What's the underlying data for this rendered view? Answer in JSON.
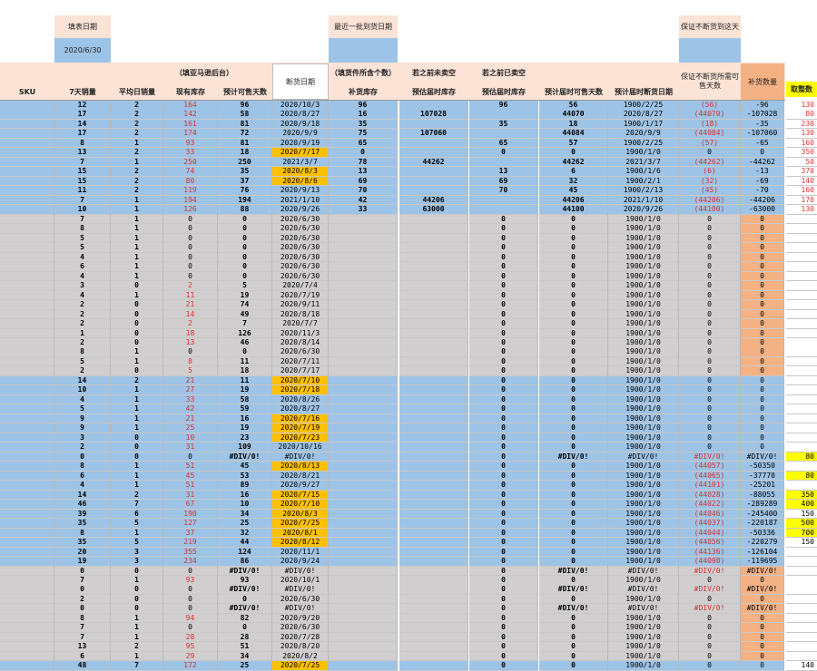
{
  "top": {
    "fill_date_label": "填表日期",
    "fill_date_value": "2020/6/30",
    "last_batch_label": "最近一批到货日期",
    "keep_stock_label": "保证不断货到这天"
  },
  "headers": {
    "amazon_backend": "（填亚马逊后台）",
    "arrival_qty": "（填货件所含个数）",
    "if_not_sold_out": "若之前未卖空",
    "if_sold_out": "若之前已卖空",
    "sku": "SKU",
    "sales_7d": "7天销量",
    "avg_daily": "平均日销量",
    "stock": "现有库存",
    "days_sellable": "预计可售天数",
    "sold_out_date": "断货日期",
    "restock": "补货库存",
    "est_stock_not": "预估届时库存",
    "est_stock_sold": "预估届时库存",
    "est_days": "预计届时可售天数",
    "est_sold_out_date": "预计届时断货日期",
    "keep_stock_days": "保证不断货所需可售天数",
    "restock_qty": "补货数量",
    "ship_qty": "取整数"
  },
  "colors": {
    "blue": "#9dc3e6",
    "gray": "#d0cece",
    "peach": "#fbe3d6",
    "orange": "#ffc000",
    "salmon": "#f4b183",
    "yellow": "#ffff00",
    "red_text": "#e03030"
  },
  "rows": [
    {
      "bg": "blue",
      "a": "12",
      "b": "2",
      "c": "164",
      "d": "96",
      "e": "2020/10/3",
      "f": "96",
      "g": "",
      "h": "96",
      "i": "56",
      "j": "1900/2/25",
      "k": "(56)",
      "l": "-96",
      "m": "130"
    },
    {
      "bg": "blue",
      "a": "17",
      "b": "2",
      "c": "142",
      "d": "58",
      "e": "2020/8/27",
      "f": "16",
      "g": "107028",
      "h": "",
      "i": "44070",
      "j": "2020/8/27",
      "k": "(44070)",
      "l": "-107028",
      "m": "80"
    },
    {
      "bg": "blue",
      "a": "14",
      "b": "2",
      "c": "161",
      "d": "81",
      "e": "2020/9/18",
      "f": "35",
      "g": "",
      "h": "35",
      "i": "18",
      "j": "1900/1/17",
      "k": "(18)",
      "l": "-35",
      "m": "230"
    },
    {
      "bg": "blue",
      "a": "17",
      "b": "2",
      "c": "174",
      "d": "72",
      "e": "2020/9/9",
      "f": "75",
      "g": "107060",
      "h": "",
      "i": "44084",
      "j": "2020/9/9",
      "k": "(44084)",
      "l": "-107060",
      "m": "130"
    },
    {
      "bg": "blue",
      "a": "8",
      "b": "1",
      "c": "93",
      "d": "81",
      "e": "2020/9/19",
      "f": "65",
      "g": "",
      "h": "65",
      "i": "57",
      "j": "1900/2/25",
      "k": "(57)",
      "l": "-65",
      "m": "160"
    },
    {
      "bg": "blue",
      "a": "13",
      "b": "2",
      "c": "33",
      "d": "18",
      "e": "2020/7/17",
      "eo": 1,
      "f": "0",
      "g": "",
      "h": "0",
      "i": "0",
      "j": "1900/1/0",
      "k": "0",
      "l": "0",
      "m": "350"
    },
    {
      "bg": "blue",
      "a": "7",
      "b": "1",
      "c": "250",
      "d": "250",
      "e": "2021/3/7",
      "f": "78",
      "g": "44262",
      "h": "",
      "i": "44262",
      "j": "2021/3/7",
      "k": "(44262)",
      "l": "-44262",
      "m": "50"
    },
    {
      "bg": "blue",
      "a": "15",
      "b": "2",
      "c": "74",
      "d": "35",
      "e": "2020/8/3",
      "eo": 1,
      "f": "13",
      "g": "",
      "h": "13",
      "i": "6",
      "j": "1900/1/6",
      "k": "(6)",
      "l": "-13",
      "m": "370"
    },
    {
      "bg": "blue",
      "a": "15",
      "b": "2",
      "c": "80",
      "d": "37",
      "e": "2020/8/6",
      "eo": 1,
      "f": "69",
      "g": "",
      "h": "69",
      "i": "32",
      "j": "1900/2/1",
      "k": "(32)",
      "l": "-69",
      "m": "140"
    },
    {
      "bg": "blue",
      "a": "11",
      "b": "2",
      "c": "119",
      "d": "76",
      "e": "2020/9/13",
      "f": "70",
      "g": "",
      "h": "70",
      "i": "45",
      "j": "1900/2/13",
      "k": "(45)",
      "l": "-70",
      "m": "160"
    },
    {
      "bg": "blue",
      "a": "7",
      "b": "1",
      "c": "194",
      "d": "194",
      "e": "2021/1/10",
      "f": "42",
      "g": "44206",
      "h": "",
      "i": "44206",
      "j": "2021/1/10",
      "k": "(44206)",
      "l": "-44206",
      "m": "170"
    },
    {
      "bg": "blue",
      "a": "10",
      "b": "1",
      "c": "126",
      "d": "88",
      "e": "2020/9/26",
      "f": "33",
      "g": "63000",
      "h": "",
      "i": "44100",
      "j": "2020/9/26",
      "k": "(44100)",
      "l": "-63000",
      "m": "130"
    },
    {
      "bg": "gray",
      "a": "7",
      "b": "1",
      "c": "0",
      "d": "0",
      "e": "2020/6/30",
      "f": "",
      "g": "",
      "h": "0",
      "i": "0",
      "j": "1900/1/0",
      "k": "0",
      "l": "0",
      "m": ""
    },
    {
      "bg": "gray",
      "a": "8",
      "b": "1",
      "c": "0",
      "d": "0",
      "e": "2020/6/30",
      "f": "",
      "g": "",
      "h": "0",
      "i": "0",
      "j": "1900/1/0",
      "k": "0",
      "l": "0",
      "m": ""
    },
    {
      "bg": "gray",
      "a": "5",
      "b": "1",
      "c": "0",
      "d": "0",
      "e": "2020/6/30",
      "f": "",
      "g": "",
      "h": "0",
      "i": "0",
      "j": "1900/1/0",
      "k": "0",
      "l": "0",
      "m": ""
    },
    {
      "bg": "gray",
      "a": "5",
      "b": "1",
      "c": "0",
      "d": "0",
      "e": "2020/6/30",
      "f": "",
      "g": "",
      "h": "0",
      "i": "0",
      "j": "1900/1/0",
      "k": "0",
      "l": "0",
      "m": ""
    },
    {
      "bg": "gray",
      "a": "4",
      "b": "1",
      "c": "0",
      "d": "0",
      "e": "2020/6/30",
      "f": "",
      "g": "",
      "h": "0",
      "i": "0",
      "j": "1900/1/0",
      "k": "0",
      "l": "0",
      "m": ""
    },
    {
      "bg": "gray",
      "a": "6",
      "b": "1",
      "c": "0",
      "d": "0",
      "e": "2020/6/30",
      "f": "",
      "g": "",
      "h": "0",
      "i": "0",
      "j": "1900/1/0",
      "k": "0",
      "l": "0",
      "m": ""
    },
    {
      "bg": "gray",
      "a": "4",
      "b": "1",
      "c": "0",
      "d": "0",
      "e": "2020/6/30",
      "f": "",
      "g": "",
      "h": "0",
      "i": "0",
      "j": "1900/1/0",
      "k": "0",
      "l": "0",
      "m": ""
    },
    {
      "bg": "gray",
      "a": "3",
      "b": "0",
      "c": "2",
      "d": "5",
      "e": "2020/7/4",
      "f": "",
      "g": "",
      "h": "0",
      "i": "0",
      "j": "1900/1/0",
      "k": "0",
      "l": "0",
      "m": ""
    },
    {
      "bg": "gray",
      "a": "4",
      "b": "1",
      "c": "11",
      "d": "19",
      "e": "2020/7/19",
      "f": "",
      "g": "",
      "h": "0",
      "i": "0",
      "j": "1900/1/0",
      "k": "0",
      "l": "0",
      "m": ""
    },
    {
      "bg": "gray",
      "a": "2",
      "b": "0",
      "c": "21",
      "d": "74",
      "e": "2020/9/11",
      "f": "",
      "g": "",
      "h": "0",
      "i": "0",
      "j": "1900/1/0",
      "k": "0",
      "l": "0",
      "m": ""
    },
    {
      "bg": "gray",
      "a": "2",
      "b": "0",
      "c": "14",
      "d": "49",
      "e": "2020/8/18",
      "f": "",
      "g": "",
      "h": "0",
      "i": "0",
      "j": "1900/1/0",
      "k": "0",
      "l": "0",
      "m": ""
    },
    {
      "bg": "gray",
      "a": "2",
      "b": "0",
      "c": "2",
      "d": "7",
      "e": "2020/7/7",
      "f": "",
      "g": "",
      "h": "0",
      "i": "0",
      "j": "1900/1/0",
      "k": "0",
      "l": "0",
      "m": ""
    },
    {
      "bg": "gray",
      "a": "1",
      "b": "0",
      "c": "18",
      "d": "126",
      "e": "2020/11/3",
      "f": "",
      "g": "",
      "h": "0",
      "i": "0",
      "j": "1900/1/0",
      "k": "0",
      "l": "0",
      "m": ""
    },
    {
      "bg": "gray",
      "a": "2",
      "b": "0",
      "c": "13",
      "d": "46",
      "e": "2020/8/14",
      "f": "",
      "g": "",
      "h": "0",
      "i": "0",
      "j": "1900/1/0",
      "k": "0",
      "l": "0",
      "m": ""
    },
    {
      "bg": "gray",
      "a": "8",
      "b": "1",
      "c": "0",
      "d": "0",
      "e": "2020/6/30",
      "f": "",
      "g": "",
      "h": "0",
      "i": "0",
      "j": "1900/1/0",
      "k": "0",
      "l": "0",
      "m": ""
    },
    {
      "bg": "gray",
      "a": "5",
      "b": "1",
      "c": "8",
      "d": "11",
      "e": "2020/7/11",
      "f": "",
      "g": "",
      "h": "0",
      "i": "0",
      "j": "1900/1/0",
      "k": "0",
      "l": "0",
      "m": ""
    },
    {
      "bg": "gray",
      "a": "2",
      "b": "0",
      "c": "5",
      "d": "18",
      "e": "2020/7/17",
      "f": "",
      "g": "",
      "h": "0",
      "i": "0",
      "j": "1900/1/0",
      "k": "0",
      "l": "0",
      "m": ""
    },
    {
      "bg": "blue",
      "a": "14",
      "b": "2",
      "c": "21",
      "d": "11",
      "e": "2020/7/10",
      "eo": 1,
      "f": "",
      "g": "",
      "h": "0",
      "i": "0",
      "j": "1900/1/0",
      "k": "0",
      "l": "0",
      "m": ""
    },
    {
      "bg": "blue",
      "a": "10",
      "b": "1",
      "c": "27",
      "d": "19",
      "e": "2020/7/18",
      "eo": 1,
      "f": "",
      "g": "",
      "h": "0",
      "i": "0",
      "j": "1900/1/0",
      "k": "0",
      "l": "0",
      "m": ""
    },
    {
      "bg": "blue",
      "a": "4",
      "b": "1",
      "c": "33",
      "d": "58",
      "e": "2020/8/26",
      "f": "",
      "g": "",
      "h": "0",
      "i": "0",
      "j": "1900/1/0",
      "k": "0",
      "l": "0",
      "m": ""
    },
    {
      "bg": "blue",
      "a": "5",
      "b": "1",
      "c": "42",
      "d": "59",
      "e": "2020/8/27",
      "f": "",
      "g": "",
      "h": "0",
      "i": "0",
      "j": "1900/1/0",
      "k": "0",
      "l": "0",
      "m": ""
    },
    {
      "bg": "blue",
      "a": "9",
      "b": "1",
      "c": "21",
      "d": "16",
      "e": "2020/7/16",
      "eo": 1,
      "f": "",
      "g": "",
      "h": "0",
      "i": "0",
      "j": "1900/1/0",
      "k": "0",
      "l": "0",
      "m": ""
    },
    {
      "bg": "blue",
      "a": "9",
      "b": "1",
      "c": "25",
      "d": "19",
      "e": "2020/7/19",
      "eo": 1,
      "f": "",
      "g": "",
      "h": "0",
      "i": "0",
      "j": "1900/1/0",
      "k": "0",
      "l": "0",
      "m": ""
    },
    {
      "bg": "blue",
      "a": "3",
      "b": "0",
      "c": "10",
      "d": "23",
      "e": "2020/7/23",
      "eo": 1,
      "f": "",
      "g": "",
      "h": "0",
      "i": "0",
      "j": "1900/1/0",
      "k": "0",
      "l": "0",
      "m": ""
    },
    {
      "bg": "blue",
      "a": "2",
      "b": "0",
      "c": "31",
      "d": "109",
      "e": "2020/10/16",
      "f": "",
      "g": "",
      "h": "0",
      "i": "0",
      "j": "1900/1/0",
      "k": "0",
      "l": "0",
      "m": ""
    },
    {
      "bg": "blue",
      "a": "0",
      "b": "0",
      "c": "0",
      "d": "#DIV/0!",
      "e": "#DIV/0!",
      "f": "",
      "g": "",
      "h": "0",
      "i": "#DIV/0!",
      "j": "#DIV/0!",
      "k": "#DIV/0!",
      "l": "#DIV/0!",
      "m": "80",
      "my": 1
    },
    {
      "bg": "blue",
      "a": "8",
      "b": "1",
      "c": "51",
      "d": "45",
      "e": "2020/8/13",
      "eo": 1,
      "f": "",
      "g": "",
      "h": "0",
      "i": "0",
      "j": "1900/1/0",
      "k": "(44057)",
      "l": "-50350",
      "m": ""
    },
    {
      "bg": "blue",
      "a": "6",
      "b": "1",
      "c": "45",
      "d": "53",
      "e": "2020/8/21",
      "f": "",
      "g": "",
      "h": "0",
      "i": "0",
      "j": "1900/1/0",
      "k": "(44065)",
      "l": "-37770",
      "m": "80",
      "my": 1
    },
    {
      "bg": "blue",
      "a": "4",
      "b": "1",
      "c": "51",
      "d": "89",
      "e": "2020/9/27",
      "f": "",
      "g": "",
      "h": "0",
      "i": "0",
      "j": "1900/1/0",
      "k": "(44101)",
      "l": "-25201",
      "m": ""
    },
    {
      "bg": "blue",
      "a": "14",
      "b": "2",
      "c": "31",
      "d": "16",
      "e": "2020/7/15",
      "eo": 1,
      "f": "",
      "g": "",
      "h": "0",
      "i": "0",
      "j": "1900/1/0",
      "k": "(44028)",
      "l": "-88055",
      "m": "350",
      "my": 1
    },
    {
      "bg": "blue",
      "a": "46",
      "b": "7",
      "c": "67",
      "d": "10",
      "e": "2020/7/10",
      "eo": 1,
      "f": "",
      "g": "",
      "h": "0",
      "i": "0",
      "j": "1900/1/0",
      "k": "(44022)",
      "l": "-289289",
      "m": "400",
      "my": 1
    },
    {
      "bg": "blue",
      "a": "39",
      "b": "6",
      "c": "190",
      "d": "34",
      "e": "2020/8/3",
      "eo": 1,
      "f": "",
      "g": "",
      "h": "0",
      "i": "0",
      "j": "1900/1/0",
      "k": "(44046)",
      "l": "-245400",
      "m": "150"
    },
    {
      "bg": "blue",
      "a": "35",
      "b": "5",
      "c": "127",
      "d": "25",
      "e": "2020/7/25",
      "eo": 1,
      "f": "",
      "g": "",
      "h": "0",
      "i": "0",
      "j": "1900/1/0",
      "k": "(44037)",
      "l": "-220187",
      "m": "500",
      "my": 1
    },
    {
      "bg": "blue",
      "a": "8",
      "b": "1",
      "c": "37",
      "d": "32",
      "e": "2020/8/1",
      "eo": 1,
      "f": "",
      "g": "",
      "h": "0",
      "i": "0",
      "j": "1900/1/0",
      "k": "(44044)",
      "l": "-50336",
      "m": "700",
      "my": 1
    },
    {
      "bg": "blue",
      "a": "35",
      "b": "5",
      "c": "219",
      "d": "44",
      "e": "2020/8/12",
      "eo": 1,
      "f": "",
      "g": "",
      "h": "0",
      "i": "0",
      "j": "1900/1/0",
      "k": "(44056)",
      "l": "-220279",
      "m": "150"
    },
    {
      "bg": "blue",
      "a": "20",
      "b": "3",
      "c": "355",
      "d": "124",
      "e": "2020/11/1",
      "f": "",
      "g": "",
      "h": "0",
      "i": "0",
      "j": "1900/1/0",
      "k": "(44136)",
      "l": "-126104",
      "m": ""
    },
    {
      "bg": "blue",
      "a": "19",
      "b": "3",
      "c": "234",
      "d": "86",
      "e": "2020/9/24",
      "f": "",
      "g": "",
      "h": "0",
      "i": "0",
      "j": "1900/1/0",
      "k": "(44098)",
      "l": "-119695",
      "m": ""
    },
    {
      "bg": "gray",
      "a": "0",
      "b": "0",
      "c": "0",
      "d": "#DIV/0!",
      "e": "#DIV/0!",
      "f": "",
      "g": "",
      "h": "0",
      "i": "#DIV/0!",
      "j": "#DIV/0!",
      "k": "#DIV/0!",
      "l": "#DIV/0!",
      "m": ""
    },
    {
      "bg": "gray",
      "a": "7",
      "b": "1",
      "c": "93",
      "d": "93",
      "e": "2020/10/1",
      "f": "",
      "g": "",
      "h": "0",
      "i": "0",
      "j": "1900/1/0",
      "k": "0",
      "l": "0",
      "m": ""
    },
    {
      "bg": "gray",
      "a": "0",
      "b": "0",
      "c": "0",
      "d": "#DIV/0!",
      "e": "#DIV/0!",
      "f": "",
      "g": "",
      "h": "0",
      "i": "#DIV/0!",
      "j": "#DIV/0!",
      "k": "#DIV/0!",
      "l": "#DIV/0!",
      "m": ""
    },
    {
      "bg": "gray",
      "a": "2",
      "b": "0",
      "c": "0",
      "d": "0",
      "e": "2020/6/30",
      "f": "",
      "g": "",
      "h": "0",
      "i": "0",
      "j": "1900/1/0",
      "k": "0",
      "l": "0",
      "m": ""
    },
    {
      "bg": "gray",
      "a": "0",
      "b": "0",
      "c": "0",
      "d": "#DIV/0!",
      "e": "#DIV/0!",
      "f": "",
      "g": "",
      "h": "0",
      "i": "#DIV/0!",
      "j": "#DIV/0!",
      "k": "#DIV/0!",
      "l": "#DIV/0!",
      "m": ""
    },
    {
      "bg": "gray",
      "a": "8",
      "b": "1",
      "c": "94",
      "d": "82",
      "e": "2020/9/20",
      "f": "",
      "g": "",
      "h": "0",
      "i": "0",
      "j": "1900/1/0",
      "k": "0",
      "l": "0",
      "m": ""
    },
    {
      "bg": "gray",
      "a": "7",
      "b": "1",
      "c": "0",
      "d": "0",
      "e": "2020/6/30",
      "f": "",
      "g": "",
      "h": "0",
      "i": "0",
      "j": "1900/1/0",
      "k": "0",
      "l": "0",
      "m": ""
    },
    {
      "bg": "gray",
      "a": "7",
      "b": "1",
      "c": "28",
      "d": "28",
      "e": "2020/7/28",
      "f": "",
      "g": "",
      "h": "0",
      "i": "0",
      "j": "1900/1/0",
      "k": "0",
      "l": "0",
      "m": ""
    },
    {
      "bg": "gray",
      "a": "13",
      "b": "2",
      "c": "95",
      "d": "51",
      "e": "2020/8/20",
      "f": "",
      "g": "",
      "h": "0",
      "i": "0",
      "j": "1900/1/0",
      "k": "0",
      "l": "0",
      "m": ""
    },
    {
      "bg": "gray",
      "a": "6",
      "b": "1",
      "c": "29",
      "d": "34",
      "e": "2020/8/2",
      "f": "",
      "g": "",
      "h": "0",
      "i": "0",
      "j": "1900/1/0",
      "k": "0",
      "l": "0",
      "m": ""
    },
    {
      "bg": "blue",
      "a": "48",
      "b": "7",
      "c": "172",
      "d": "25",
      "e": "2020/7/25",
      "eo": 1,
      "f": "",
      "g": "",
      "h": "0",
      "i": "0",
      "j": "1900/1/0",
      "k": "0",
      "l": "0",
      "m": "140"
    }
  ]
}
